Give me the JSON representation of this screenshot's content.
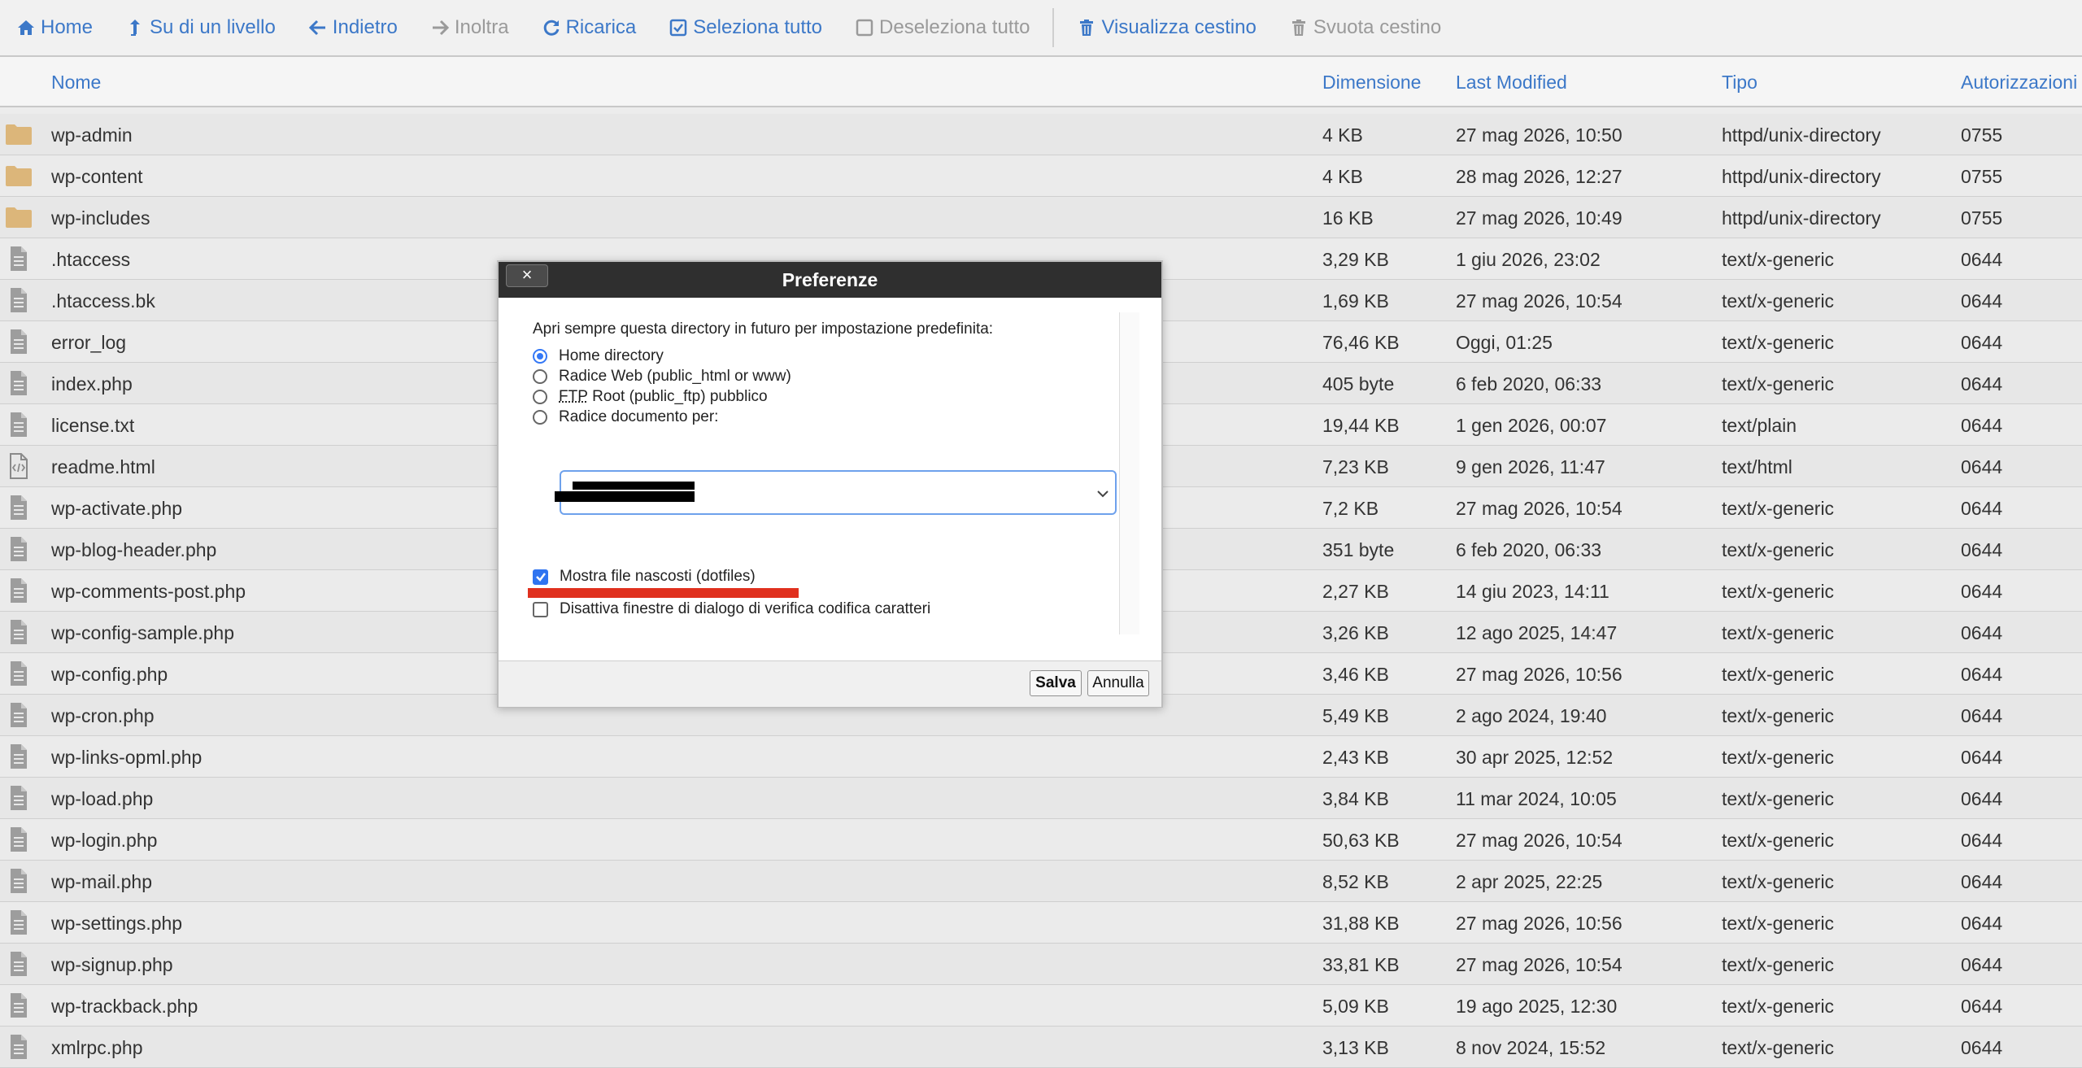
{
  "toolbar": {
    "items": [
      {
        "label": "Home",
        "icon": "home-icon",
        "enabled": true
      },
      {
        "label": "Su di un livello",
        "icon": "level-up-icon",
        "enabled": true
      },
      {
        "label": "Indietro",
        "icon": "arrow-left-icon",
        "enabled": true
      },
      {
        "label": "Inoltra",
        "icon": "arrow-right-icon",
        "enabled": false
      },
      {
        "label": "Ricarica",
        "icon": "refresh-icon",
        "enabled": true
      },
      {
        "label": "Seleziona tutto",
        "icon": "checked-square-icon",
        "enabled": true
      },
      {
        "label": "Deseleziona tutto",
        "icon": "empty-square-icon",
        "enabled": false
      },
      {
        "label": "Visualizza cestino",
        "icon": "trash-icon",
        "enabled": true
      },
      {
        "label": "Svuota cestino",
        "icon": "trash-icon",
        "enabled": false
      }
    ]
  },
  "table": {
    "headers": {
      "name": "Nome",
      "size": "Dimensione",
      "modified": "Last Modified",
      "type": "Tipo",
      "perms": "Autorizzazioni"
    },
    "rows": [
      {
        "icon": "folder-icon",
        "name": "wp-admin",
        "size": "4 KB",
        "modified": "27 mag 2026, 10:50",
        "type": "httpd/unix-directory",
        "perms": "0755"
      },
      {
        "icon": "folder-icon",
        "name": "wp-content",
        "size": "4 KB",
        "modified": "28 mag 2026, 12:27",
        "type": "httpd/unix-directory",
        "perms": "0755"
      },
      {
        "icon": "folder-icon",
        "name": "wp-includes",
        "size": "16 KB",
        "modified": "27 mag 2026, 10:49",
        "type": "httpd/unix-directory",
        "perms": "0755"
      },
      {
        "icon": "file-icon",
        "name": ".htaccess",
        "size": "3,29 KB",
        "modified": "1 giu 2026, 23:02",
        "type": "text/x-generic",
        "perms": "0644"
      },
      {
        "icon": "file-icon",
        "name": ".htaccess.bk",
        "size": "1,69 KB",
        "modified": "27 mag 2026, 10:54",
        "type": "text/x-generic",
        "perms": "0644"
      },
      {
        "icon": "file-icon",
        "name": "error_log",
        "size": "76,46 KB",
        "modified": "Oggi, 01:25",
        "type": "text/x-generic",
        "perms": "0644"
      },
      {
        "icon": "file-icon",
        "name": "index.php",
        "size": "405 byte",
        "modified": "6 feb 2020, 06:33",
        "type": "text/x-generic",
        "perms": "0644"
      },
      {
        "icon": "file-icon",
        "name": "license.txt",
        "size": "19,44 KB",
        "modified": "1 gen 2026, 00:07",
        "type": "text/plain",
        "perms": "0644"
      },
      {
        "icon": "code-file-icon",
        "name": "readme.html",
        "size": "7,23 KB",
        "modified": "9 gen 2026, 11:47",
        "type": "text/html",
        "perms": "0644"
      },
      {
        "icon": "file-icon",
        "name": "wp-activate.php",
        "size": "7,2 KB",
        "modified": "27 mag 2026, 10:54",
        "type": "text/x-generic",
        "perms": "0644"
      },
      {
        "icon": "file-icon",
        "name": "wp-blog-header.php",
        "size": "351 byte",
        "modified": "6 feb 2020, 06:33",
        "type": "text/x-generic",
        "perms": "0644"
      },
      {
        "icon": "file-icon",
        "name": "wp-comments-post.php",
        "size": "2,27 KB",
        "modified": "14 giu 2023, 14:11",
        "type": "text/x-generic",
        "perms": "0644"
      },
      {
        "icon": "file-icon",
        "name": "wp-config-sample.php",
        "size": "3,26 KB",
        "modified": "12 ago 2025, 14:47",
        "type": "text/x-generic",
        "perms": "0644"
      },
      {
        "icon": "file-icon",
        "name": "wp-config.php",
        "size": "3,46 KB",
        "modified": "27 mag 2026, 10:56",
        "type": "text/x-generic",
        "perms": "0644"
      },
      {
        "icon": "file-icon",
        "name": "wp-cron.php",
        "size": "5,49 KB",
        "modified": "2 ago 2024, 19:40",
        "type": "text/x-generic",
        "perms": "0644"
      },
      {
        "icon": "file-icon",
        "name": "wp-links-opml.php",
        "size": "2,43 KB",
        "modified": "30 apr 2025, 12:52",
        "type": "text/x-generic",
        "perms": "0644"
      },
      {
        "icon": "file-icon",
        "name": "wp-load.php",
        "size": "3,84 KB",
        "modified": "11 mar 2024, 10:05",
        "type": "text/x-generic",
        "perms": "0644"
      },
      {
        "icon": "file-icon",
        "name": "wp-login.php",
        "size": "50,63 KB",
        "modified": "27 mag 2026, 10:54",
        "type": "text/x-generic",
        "perms": "0644"
      },
      {
        "icon": "file-icon",
        "name": "wp-mail.php",
        "size": "8,52 KB",
        "modified": "2 apr 2025, 22:25",
        "type": "text/x-generic",
        "perms": "0644"
      },
      {
        "icon": "file-icon",
        "name": "wp-settings.php",
        "size": "31,88 KB",
        "modified": "27 mag 2026, 10:56",
        "type": "text/x-generic",
        "perms": "0644"
      },
      {
        "icon": "file-icon",
        "name": "wp-signup.php",
        "size": "33,81 KB",
        "modified": "27 mag 2026, 10:54",
        "type": "text/x-generic",
        "perms": "0644"
      },
      {
        "icon": "file-icon",
        "name": "wp-trackback.php",
        "size": "5,09 KB",
        "modified": "19 ago 2025, 12:30",
        "type": "text/x-generic",
        "perms": "0644"
      },
      {
        "icon": "file-icon",
        "name": "xmlrpc.php",
        "size": "3,13 KB",
        "modified": "8 nov 2024, 15:52",
        "type": "text/x-generic",
        "perms": "0644"
      }
    ]
  },
  "modal": {
    "title": "Preferenze",
    "close_label": "×",
    "intro": "Apri sempre questa directory in futuro per impostazione predefinita:",
    "radio_home": "Home directory",
    "radio_web": "Radice Web (public_html or www)",
    "radio_ftp_abbr": "FTP",
    "radio_ftp_rest": " Root (public_ftp) pubblico",
    "radio_docroot": "Radice documento per:",
    "selected_radio": "home",
    "check_dotfiles": "Mostra file nascosti (dotfiles)",
    "check_dotfiles_checked": true,
    "check_encoding": "Disattiva finestre di dialogo di verifica codifica caratteri",
    "check_encoding_checked": false,
    "save_label": "Salva",
    "cancel_label": "Annulla"
  },
  "colors": {
    "accent": "#3c78c8",
    "folder": "#dcb67a",
    "file": "#9d9d9d",
    "highlight": "#e0301e"
  }
}
